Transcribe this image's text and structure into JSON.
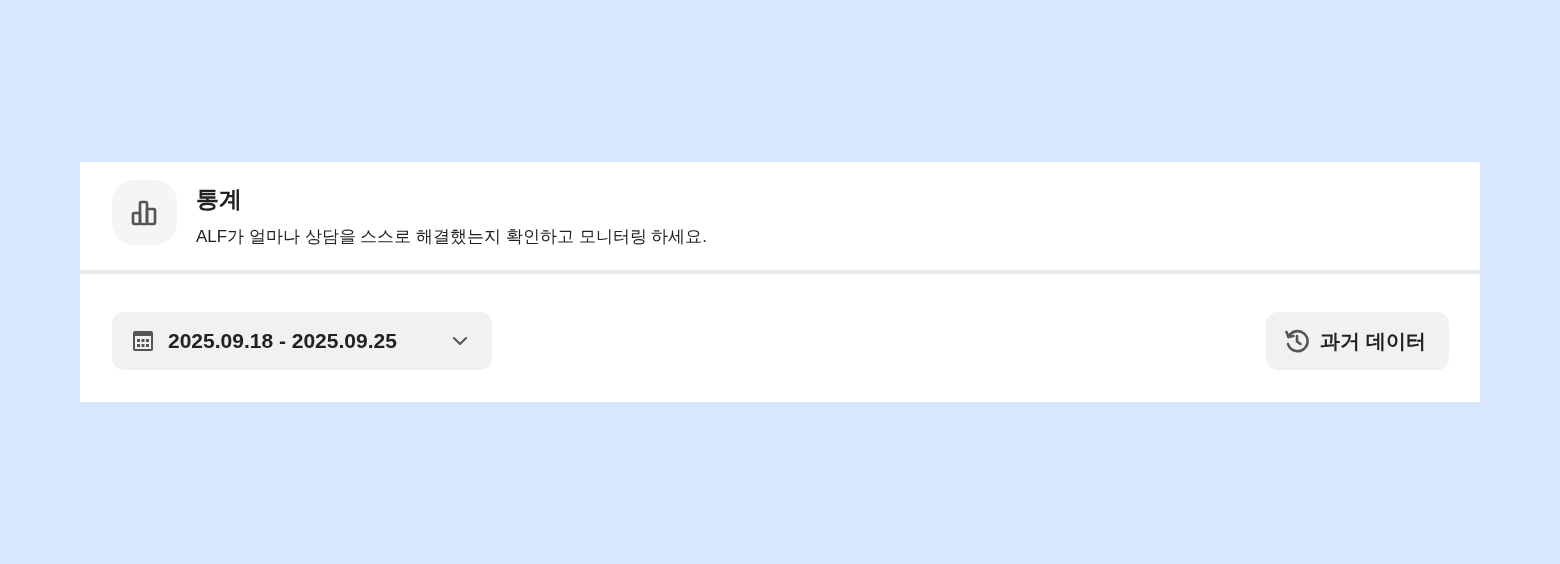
{
  "header": {
    "title": "통계",
    "description": "ALF가 얼마나 상담을 스스로 해결했는지 확인하고 모니터링 하세요."
  },
  "toolbar": {
    "date_range": "2025.09.18 - 2025.09.25",
    "history_button": "과거 데이터"
  }
}
